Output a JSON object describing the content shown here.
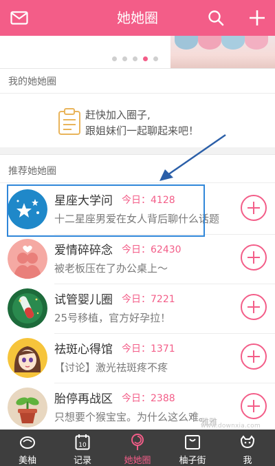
{
  "header": {
    "title": "她她圈"
  },
  "banner": {
    "dot_count": 5,
    "active_dot": 3
  },
  "my_circle": {
    "section_title": "我的她她圈",
    "empty_line1": "赶快加入圈子,",
    "empty_line2": "跟姐妹们一起聊起来吧！"
  },
  "recommended": {
    "section_title": "推荐她她圈",
    "items": [
      {
        "name": "星座大学问",
        "today": "今日：4128",
        "desc": "十二星座男爱在女人背后聊什么话题",
        "avatar": "stars-icon"
      },
      {
        "name": "爱情碎碎念",
        "today": "今日：62430",
        "desc": "被老板压在了办公桌上～",
        "avatar": "couple-icon"
      },
      {
        "name": "试管婴儿圈",
        "today": "今日：7221",
        "desc": "25号移植，官方好孕拉！",
        "avatar": "test-tube-icon"
      },
      {
        "name": "祛斑心得馆",
        "today": "今日：1371",
        "desc": "【讨论】激光祛斑疼不疼",
        "avatar": "girl-icon"
      },
      {
        "name": "胎停再战区",
        "today": "今日：2388",
        "desc": "只想要个猴宝宝。为什么这么难。",
        "avatar": "sprout-icon"
      }
    ]
  },
  "bottom_nav": [
    {
      "label": "美柚",
      "icon": "meiyou-icon"
    },
    {
      "label": "记录",
      "icon": "calendar-icon"
    },
    {
      "label": "她她圈",
      "icon": "circle-lollipop-icon",
      "active": true
    },
    {
      "label": "柚子街",
      "icon": "shop-bag-icon"
    },
    {
      "label": "我",
      "icon": "profile-icon"
    }
  ],
  "colors": {
    "accent": "#f35d88",
    "nav_bg": "#3e3e3e",
    "highlight": "#2f86d9"
  },
  "watermark": {
    "line1": "雅雅",
    "line2": "www.downxia.com"
  }
}
